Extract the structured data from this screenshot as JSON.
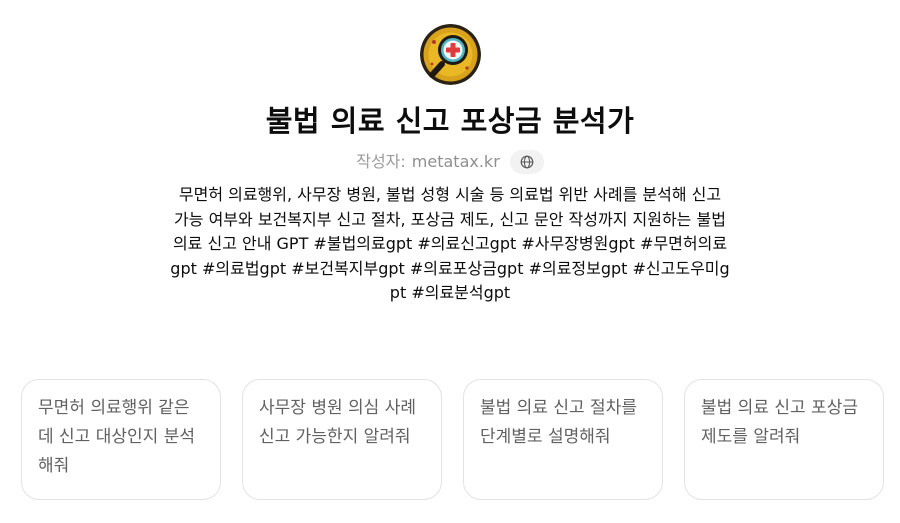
{
  "gpt": {
    "title": "불법 의료 신고 포상금 분석가",
    "author_prefix": "작성자:",
    "author_name": "metatax.kr",
    "website_icon": "globe-icon",
    "description": "무면허 의료행위, 사무장 병원, 불법 성형 시술 등 의료법 위반 사례를 분석해 신고 가능 여부와 보건복지부 신고 절차, 포상금 제도, 신고 문안 작성까지 지원하는 불법 의료 신고 안내 GPT #불법의료gpt #의료신고gpt #사무장병원gpt #무면허의료gpt #의료법gpt #보건복지부gpt #의료포상금gpt #의료정보gpt #신고도우미gpt #의료분석gpt"
  },
  "conversation_starters": [
    "무면허 의료행위 같은데 신고 대상인지 분석해줘",
    "사무장 병원 의심 사례 신고 가능한지 알려줘",
    "불법 의료 신고 절차를 단계별로 설명해줘",
    "불법 의료 신고 포상금 제도를 알려줘"
  ],
  "colors": {
    "avatar_bg": "#1e1a12",
    "avatar_gold": "#e7b21f",
    "cross_red": "#e23b3b",
    "lens_teal": "#36a6b8"
  }
}
